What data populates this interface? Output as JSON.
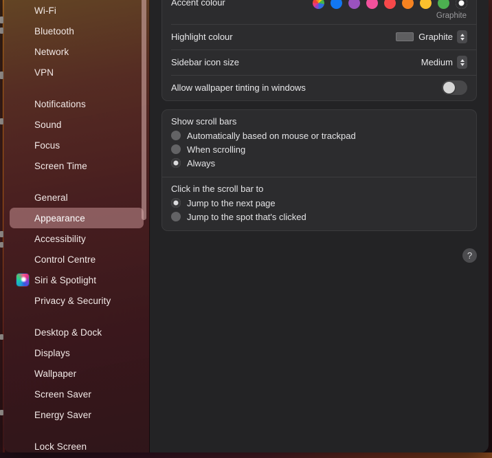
{
  "sidebar": {
    "items": [
      {
        "label": "Wi-Fi",
        "icon": "wifi-icon",
        "selected": false,
        "gap_after": false
      },
      {
        "label": "Bluetooth",
        "icon": "bluetooth-icon",
        "selected": false,
        "gap_after": false
      },
      {
        "label": "Network",
        "icon": "network-icon",
        "selected": false,
        "gap_after": false
      },
      {
        "label": "VPN",
        "icon": "vpn-icon",
        "selected": false,
        "gap_after": true
      },
      {
        "label": "Notifications",
        "icon": "notifications-icon",
        "selected": false,
        "gap_after": false
      },
      {
        "label": "Sound",
        "icon": "sound-icon",
        "selected": false,
        "gap_after": false
      },
      {
        "label": "Focus",
        "icon": "focus-icon",
        "selected": false,
        "gap_after": false
      },
      {
        "label": "Screen Time",
        "icon": "screen-time-icon",
        "selected": false,
        "gap_after": true
      },
      {
        "label": "General",
        "icon": "general-icon",
        "selected": false,
        "gap_after": false
      },
      {
        "label": "Appearance",
        "icon": "appearance-icon",
        "selected": true,
        "gap_after": false
      },
      {
        "label": "Accessibility",
        "icon": "accessibility-icon",
        "selected": false,
        "gap_after": false
      },
      {
        "label": "Control Centre",
        "icon": "control-centre-icon",
        "selected": false,
        "gap_after": false
      },
      {
        "label": "Siri & Spotlight",
        "icon": "siri-orb-icon",
        "selected": false,
        "gap_after": false
      },
      {
        "label": "Privacy & Security",
        "icon": "privacy-security-icon",
        "selected": false,
        "gap_after": true
      },
      {
        "label": "Desktop & Dock",
        "icon": "desktop-dock-icon",
        "selected": false,
        "gap_after": false
      },
      {
        "label": "Displays",
        "icon": "displays-icon",
        "selected": false,
        "gap_after": false
      },
      {
        "label": "Wallpaper",
        "icon": "wallpaper-icon",
        "selected": false,
        "gap_after": false
      },
      {
        "label": "Screen Saver",
        "icon": "screen-saver-icon",
        "selected": false,
        "gap_after": false
      },
      {
        "label": "Energy Saver",
        "icon": "energy-saver-icon",
        "selected": false,
        "gap_after": true
      },
      {
        "label": "Lock Screen",
        "icon": "lock-screen-icon",
        "selected": false,
        "gap_after": false
      }
    ]
  },
  "appearance": {
    "accent": {
      "label": "Accent colour",
      "selected_name": "Graphite",
      "swatches": [
        {
          "name": "Multicolour",
          "color": "multicolour",
          "selected": false
        },
        {
          "name": "Blue",
          "color": "#1277f2",
          "selected": false
        },
        {
          "name": "Purple",
          "color": "#9a52bf",
          "selected": false
        },
        {
          "name": "Pink",
          "color": "#f2519c",
          "selected": false
        },
        {
          "name": "Red",
          "color": "#f6484a",
          "selected": false
        },
        {
          "name": "Orange",
          "color": "#f58220",
          "selected": false
        },
        {
          "name": "Yellow",
          "color": "#fbc02d",
          "selected": false
        },
        {
          "name": "Green",
          "color": "#4cb050",
          "selected": false
        },
        {
          "name": "Graphite",
          "color": "#9a9a9d",
          "selected": true
        }
      ]
    },
    "highlight": {
      "label": "Highlight colour",
      "value": "Graphite",
      "well_color": "#5e5e60"
    },
    "sidebar_icon_size": {
      "label": "Sidebar icon size",
      "value": "Medium"
    },
    "wallpaper_tinting": {
      "label": "Allow wallpaper tinting in windows",
      "enabled": false
    },
    "show_scroll_bars": {
      "title": "Show scroll bars",
      "options": [
        {
          "label": "Automatically based on mouse or trackpad",
          "selected": false
        },
        {
          "label": "When scrolling",
          "selected": false
        },
        {
          "label": "Always",
          "selected": true
        }
      ]
    },
    "click_scroll_bar": {
      "title": "Click in the scroll bar to",
      "options": [
        {
          "label": "Jump to the next page",
          "selected": true
        },
        {
          "label": "Jump to the spot that's clicked",
          "selected": false
        }
      ]
    },
    "help": {
      "label": "?"
    }
  }
}
